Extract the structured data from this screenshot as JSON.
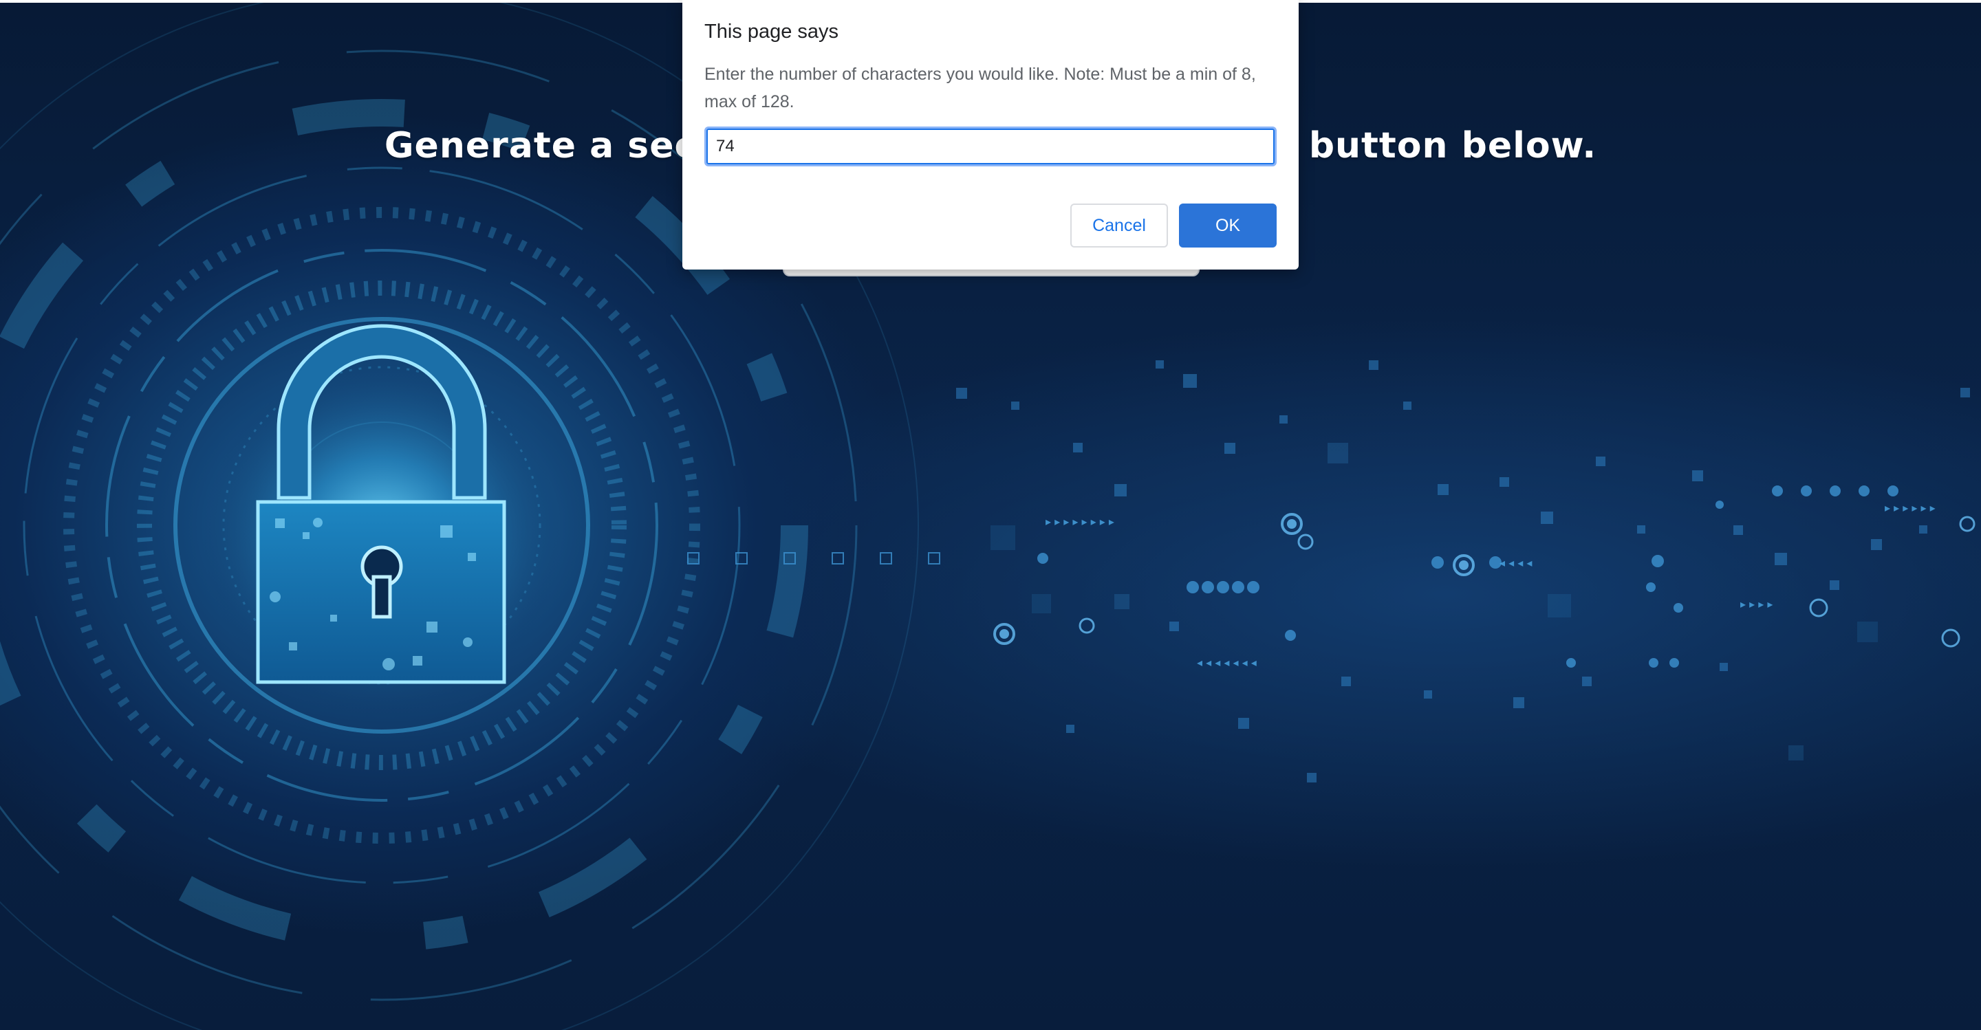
{
  "page": {
    "heading": "Generate a secure password by clicking the button below."
  },
  "dialog": {
    "title": "This page says",
    "message": "Enter the number of characters you would like. Note: Must be a min of 8, max of 128.",
    "input_value": "74",
    "cancel_label": "Cancel",
    "ok_label": "OK"
  },
  "icons": {
    "lock": "padlock-icon"
  },
  "colors": {
    "background": "#0a2449",
    "glow": "#3fb6ea",
    "ok_button": "#2b74d8",
    "cancel_text": "#1a73e8"
  }
}
